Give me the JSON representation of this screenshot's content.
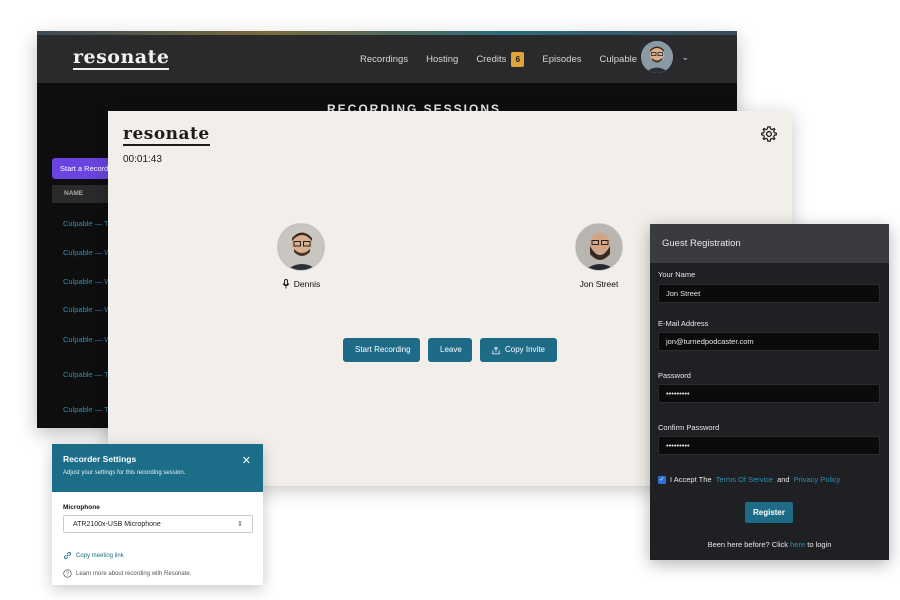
{
  "back_window": {
    "logo": "resonate",
    "nav": [
      "Recordings",
      "Hosting",
      "Credits",
      "Episodes",
      "Culpable"
    ],
    "credits_count": "6",
    "heading": "RECORDING SESSIONS",
    "start_button": "Start a Recording",
    "table_header": "NAME",
    "rows": [
      "Culpable — Tu",
      "Culpable — We",
      "Culpable — We",
      "Culpable — We",
      "Culpable — We",
      "Culpable — Tu",
      "Culpable — Tu"
    ]
  },
  "session": {
    "logo": "resonate",
    "timer": "00:01:43",
    "participants": [
      {
        "name": "Dennis",
        "mic_icon": "microphone-icon"
      },
      {
        "name": "Jon Street"
      }
    ],
    "buttons": {
      "start_recording": "Start Recording",
      "leave": "Leave",
      "copy_invite": "Copy Invite"
    }
  },
  "recorder_settings": {
    "title": "Recorder Settings",
    "subtitle": "Adjust your settings for this recording session.",
    "microphone_label": "Microphone",
    "microphone_value": "ATR2100x-USB Microphone",
    "copy_link": "Copy meeting link",
    "help": "Learn more about recording with Resonate."
  },
  "guest_registration": {
    "title": "Guest Registration",
    "name_label": "Your Name",
    "name_value": "Jon Street",
    "email_label": "E-Mail Address",
    "email_value": "jon@turnedpodcaster.com",
    "password_label": "Password",
    "password_value": "•••••••••",
    "confirm_label": "Confirm Password",
    "confirm_value": "•••••••••",
    "accept_prefix": "I Accept The",
    "terms_link": "Terms Of Service",
    "and_text": "and",
    "privacy_link": "Privacy Policy",
    "register_button": "Register",
    "login_prefix": "Been here before? Click",
    "login_link": "here",
    "login_suffix": "to login"
  }
}
